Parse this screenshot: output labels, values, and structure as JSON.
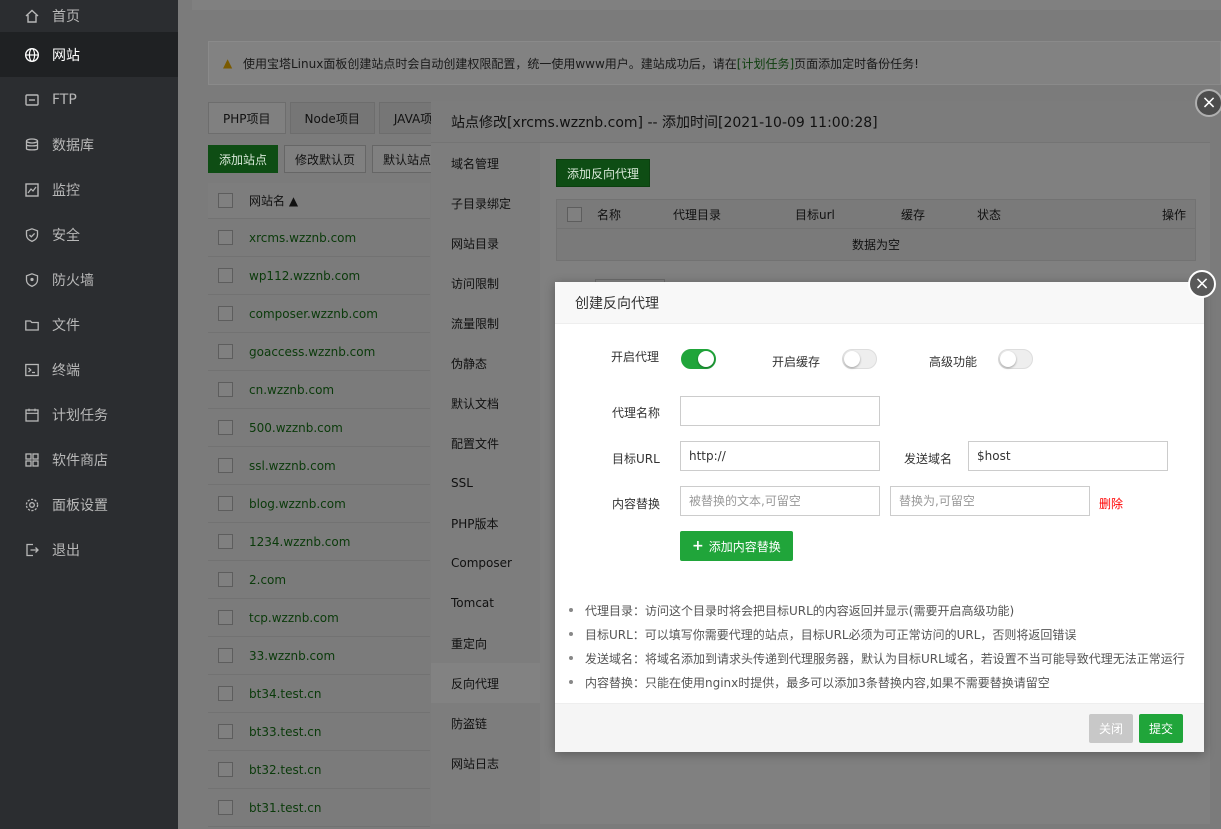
{
  "sidebar": {
    "items": [
      {
        "label": "首页",
        "icon": "home-icon"
      },
      {
        "label": "网站",
        "icon": "globe-icon"
      },
      {
        "label": "FTP",
        "icon": "ftp-icon"
      },
      {
        "label": "数据库",
        "icon": "database-icon"
      },
      {
        "label": "监控",
        "icon": "monitor-icon"
      },
      {
        "label": "安全",
        "icon": "shield-icon"
      },
      {
        "label": "防火墙",
        "icon": "firewall-icon"
      },
      {
        "label": "文件",
        "icon": "folder-icon"
      },
      {
        "label": "终端",
        "icon": "terminal-icon"
      },
      {
        "label": "计划任务",
        "icon": "calendar-icon"
      },
      {
        "label": "软件商店",
        "icon": "apps-icon"
      },
      {
        "label": "面板设置",
        "icon": "gear-icon"
      },
      {
        "label": "退出",
        "icon": "logout-icon"
      }
    ],
    "active_index": 1
  },
  "alert": {
    "text_before": "使用宝塔Linux面板创建站点时会自动创建权限配置，统一使用www用户。建站成功后，请在",
    "link": "[计划任务]",
    "text_after": "页面添加定时备份任务!"
  },
  "tabs": [
    "PHP项目",
    "Node项目",
    "JAVA项"
  ],
  "buttons": {
    "add_site": "添加站点",
    "modify_default": "修改默认页",
    "default_site": "默认站点"
  },
  "site_table": {
    "header": "网站名 ▲",
    "rows": [
      "xrcms.wzznb.com",
      "wp112.wzznb.com",
      "composer.wzznb.com",
      "goaccess.wzznb.com",
      "cn.wzznb.com",
      "500.wzznb.com",
      "ssl.wzznb.com",
      "blog.wzznb.com",
      "1234.wzznb.com",
      "2.com",
      "tcp.wzznb.com",
      "33.wzznb.com",
      "bt34.test.cn",
      "bt33.test.cn",
      "bt32.test.cn",
      "bt31.test.cn"
    ]
  },
  "site_modal": {
    "title": "站点修改[xrcms.wzznb.com] -- 添加时间[2021-10-09 11:00:28]",
    "menu": [
      "域名管理",
      "子目录绑定",
      "网站目录",
      "访问限制",
      "流量限制",
      "伪静态",
      "默认文档",
      "配置文件",
      "SSL",
      "PHP版本",
      "Composer",
      "Tomcat",
      "重定向",
      "反向代理",
      "防盗链",
      "网站日志"
    ],
    "active_menu_index": 13,
    "add_proxy_label": "添加反向代理",
    "columns": [
      "名称",
      "代理目录",
      "目标url",
      "缓存",
      "状态",
      "操作"
    ],
    "empty_text": "数据为空"
  },
  "proxy_dialog": {
    "title": "创建反向代理",
    "enable_proxy_label": "开启代理",
    "enable_proxy": true,
    "enable_cache_label": "开启缓存",
    "enable_cache": false,
    "advanced_label": "高级功能",
    "advanced": false,
    "name_label": "代理名称",
    "name_value": "",
    "target_url_label": "目标URL",
    "target_url_value": "http://",
    "send_domain_label": "发送域名",
    "send_domain_value": "$host",
    "replace_label": "内容替换",
    "replace_from_placeholder": "被替换的文本,可留空",
    "replace_to_placeholder": "替换为,可留空",
    "delete_label": "删除",
    "add_replace_label": "添加内容替换",
    "tips": [
      "代理目录：访问这个目录时将会把目标URL的内容返回并显示(需要开启高级功能)",
      "目标URL：可以填写你需要代理的站点，目标URL必须为可正常访问的URL，否则将返回错误",
      "发送域名：将域名添加到请求头传递到代理服务器，默认为目标URL域名，若设置不当可能导致代理无法正常运行",
      "内容替换：只能在使用nginx时提供，最多可以添加3条替换内容,如果不需要替换请留空"
    ],
    "close_label": "关闭",
    "submit_label": "提交"
  },
  "colors": {
    "accent": "#20a53a",
    "danger": "#ff0000",
    "sidebar_bg": "#2b2d30"
  }
}
